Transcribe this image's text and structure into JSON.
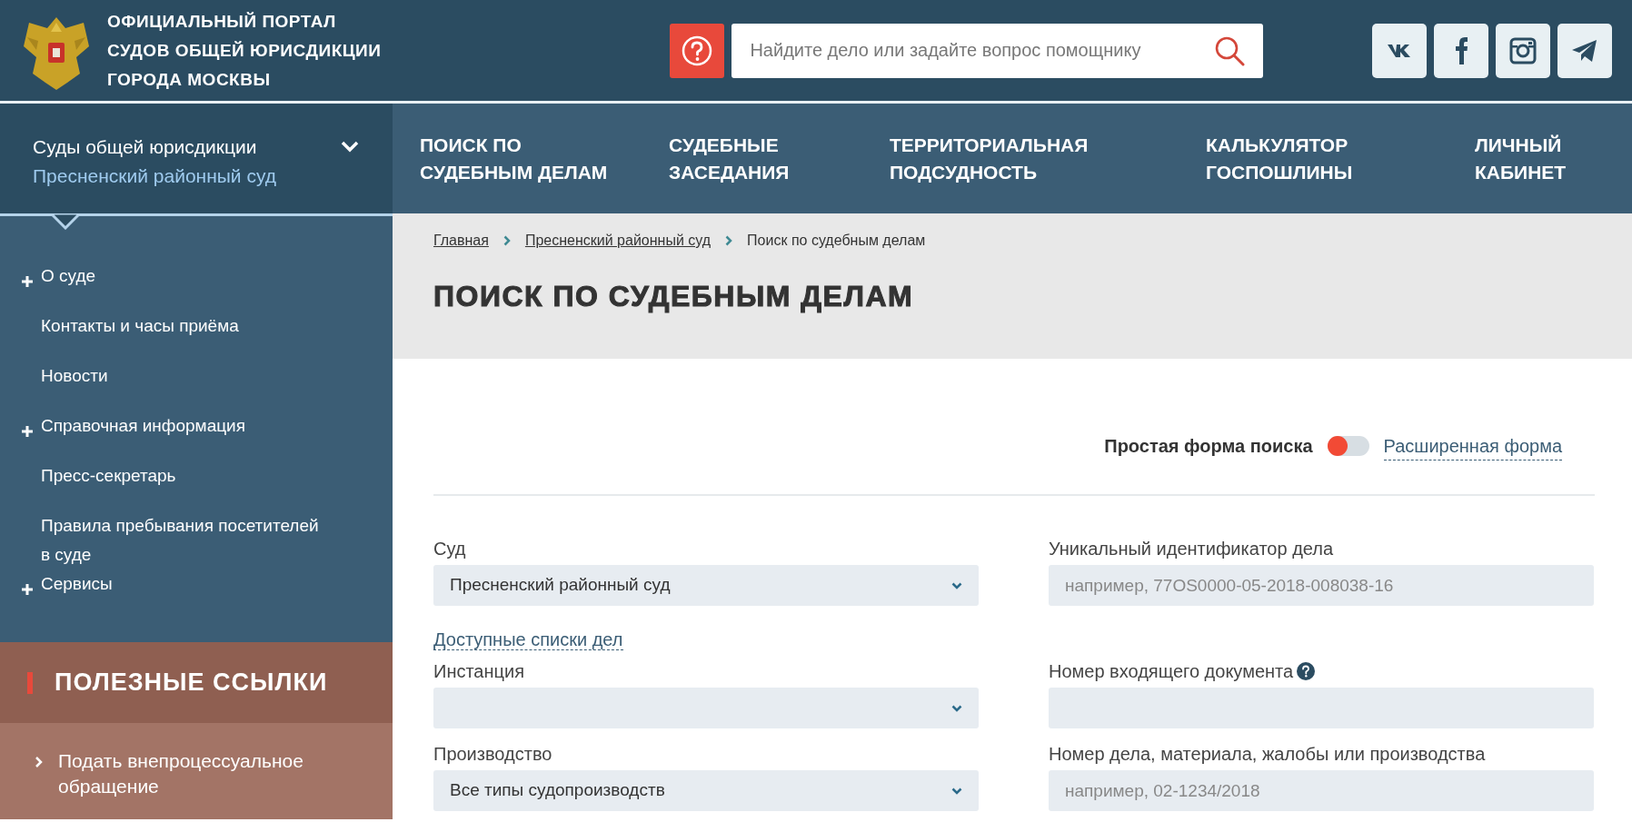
{
  "header": {
    "title_lines": [
      "ОФИЦИАЛЬНЫЙ ПОРТАЛ",
      "СУДОВ ОБЩЕЙ ЮРИСДИКЦИИ",
      "ГОРОДА МОСКВЫ"
    ],
    "search": {
      "placeholder": "Найдите дело или задайте вопрос помощнику"
    },
    "social": [
      {
        "kind": "vk"
      },
      {
        "kind": "facebook"
      },
      {
        "kind": "instagram"
      },
      {
        "kind": "telegram"
      }
    ]
  },
  "court_selector": {
    "title": "Суды общей юрисдикции",
    "subtitle": "Пресненский районный суд",
    "expanded": false
  },
  "nav": [
    {
      "lines": [
        "ПОИСК ПО",
        "СУДЕБНЫМ ДЕЛАМ"
      ]
    },
    {
      "lines": [
        "СУДЕБНЫЕ",
        "ЗАСЕДАНИЯ"
      ]
    },
    {
      "lines": [
        "ТЕРРИТОРИАЛЬНАЯ",
        "ПОДСУДНОСТЬ"
      ]
    },
    {
      "lines": [
        "КАЛЬКУЛЯТОР",
        "ГОСПОШЛИНЫ"
      ]
    },
    {
      "lines": [
        "ЛИЧНЫЙ",
        "КАБИНЕТ"
      ]
    }
  ],
  "sidebar": {
    "items": [
      {
        "label": "О суде",
        "expandable": true
      },
      {
        "label": "Контакты и часы приёма",
        "expandable": false
      },
      {
        "label": "Новости",
        "expandable": false
      },
      {
        "label": "Справочная информация",
        "expandable": true
      },
      {
        "label": "Пресс-секретарь",
        "expandable": false
      },
      {
        "label": "Правила пребывания посетителей в суде",
        "expandable": false
      },
      {
        "label": "Сервисы",
        "expandable": true
      }
    ]
  },
  "useful_links": {
    "title": "ПОЛЕЗНЫЕ ССЫЛКИ",
    "items": [
      {
        "label": "Подать внепроцессуальное обращение"
      }
    ]
  },
  "breadcrumb": [
    {
      "label": "Главная",
      "kind": "link"
    },
    {
      "label": "Пресненский районный суд",
      "kind": "link"
    },
    {
      "label": "Поиск по судебным делам",
      "kind": "current"
    }
  ],
  "page_title": "ПОИСК ПО СУДЕБНЫМ ДЕЛАМ",
  "search_mode": {
    "simple_label": "Простая форма поиска",
    "advanced_label": "Расширенная форма",
    "advanced": false
  },
  "form": {
    "rows": [
      {
        "left": {
          "kind": "select",
          "label": "Суд",
          "value": "Пресненский районный суд"
        },
        "right": {
          "kind": "input",
          "label": "Уникальный идентификатор дела",
          "placeholder": "например, 77OS0000-05-2018-008038-16"
        }
      },
      {
        "left": {
          "kind": "link",
          "label": "Доступные списки дел"
        }
      },
      {
        "left": {
          "kind": "select",
          "label": "Инстанция"
        },
        "right": {
          "kind": "input",
          "label": "Номер входящего документа",
          "help": true
        }
      },
      {
        "left": {
          "kind": "select",
          "label": "Производство",
          "value": "Все типы судопроизводств"
        },
        "right": {
          "kind": "input",
          "label": "Номер дела, материала, жалобы или производства",
          "placeholder": "например, 02-1234/2018"
        }
      }
    ]
  }
}
